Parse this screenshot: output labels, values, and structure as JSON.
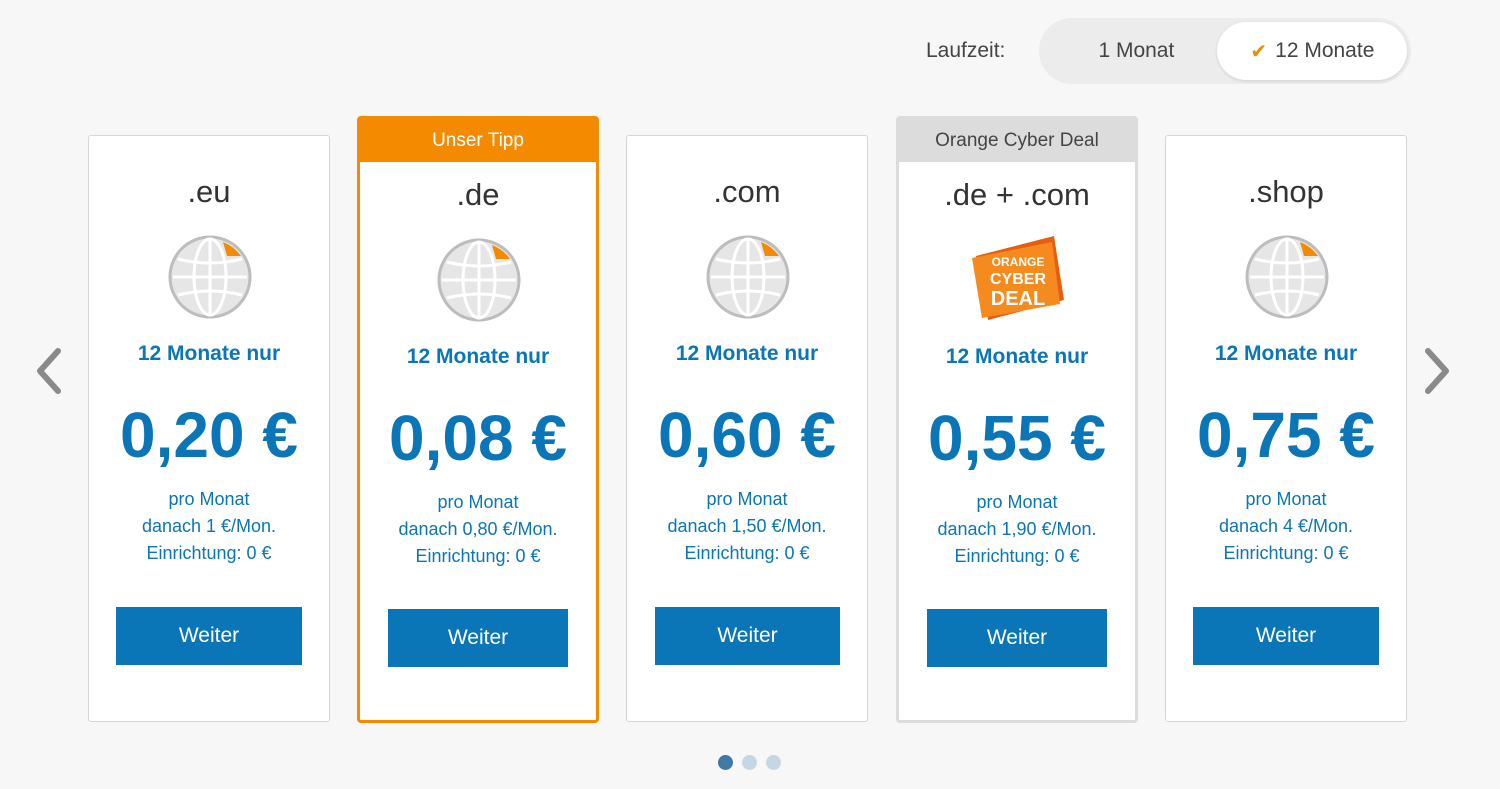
{
  "term": {
    "label": "Laufzeit:",
    "options": [
      "1 Monat",
      "12 Monate"
    ],
    "selected": "12 Monate"
  },
  "nav": {
    "prev_icon": "chevron-left-icon",
    "next_icon": "chevron-right-icon"
  },
  "cards": [
    {
      "tld": ".eu",
      "icon": "globe-icon",
      "promo": "12 Monate nur",
      "price": "0,20 €",
      "per": "pro Monat",
      "after": "danach 1 €/Mon.",
      "setup": "Einrichtung: 0 €",
      "button": "Weiter"
    },
    {
      "badge": "Unser Tipp",
      "tld": ".de",
      "icon": "globe-icon",
      "promo": "12 Monate nur",
      "price": "0,08 €",
      "per": "pro Monat",
      "after": "danach 0,80 €/Mon.",
      "setup": "Einrichtung: 0 €",
      "button": "Weiter"
    },
    {
      "tld": ".com",
      "icon": "globe-icon",
      "promo": "12 Monate nur",
      "price": "0,60 €",
      "per": "pro Monat",
      "after": "danach 1,50 €/Mon.",
      "setup": "Einrichtung: 0 €",
      "button": "Weiter"
    },
    {
      "badge": "Orange Cyber Deal",
      "tld": ".de + .com",
      "icon": "orange-cyber-deal-logo",
      "logo_text": [
        "ORANGE",
        "CYBER",
        "DEAL"
      ],
      "promo": "12 Monate nur",
      "price": "0,55 €",
      "per": "pro Monat",
      "after": "danach 1,90 €/Mon.",
      "setup": "Einrichtung: 0 €",
      "button": "Weiter"
    },
    {
      "tld": ".shop",
      "icon": "globe-icon",
      "promo": "12 Monate nur",
      "price": "0,75 €",
      "per": "pro Monat",
      "after": "danach 4 €/Mon.",
      "setup": "Einrichtung: 0 €",
      "button": "Weiter"
    }
  ],
  "pagination": {
    "pages": 3,
    "active": 1
  },
  "colors": {
    "accent": "#0a76b7",
    "highlight": "#f38a00",
    "deal_gray": "#dcdcdc"
  }
}
